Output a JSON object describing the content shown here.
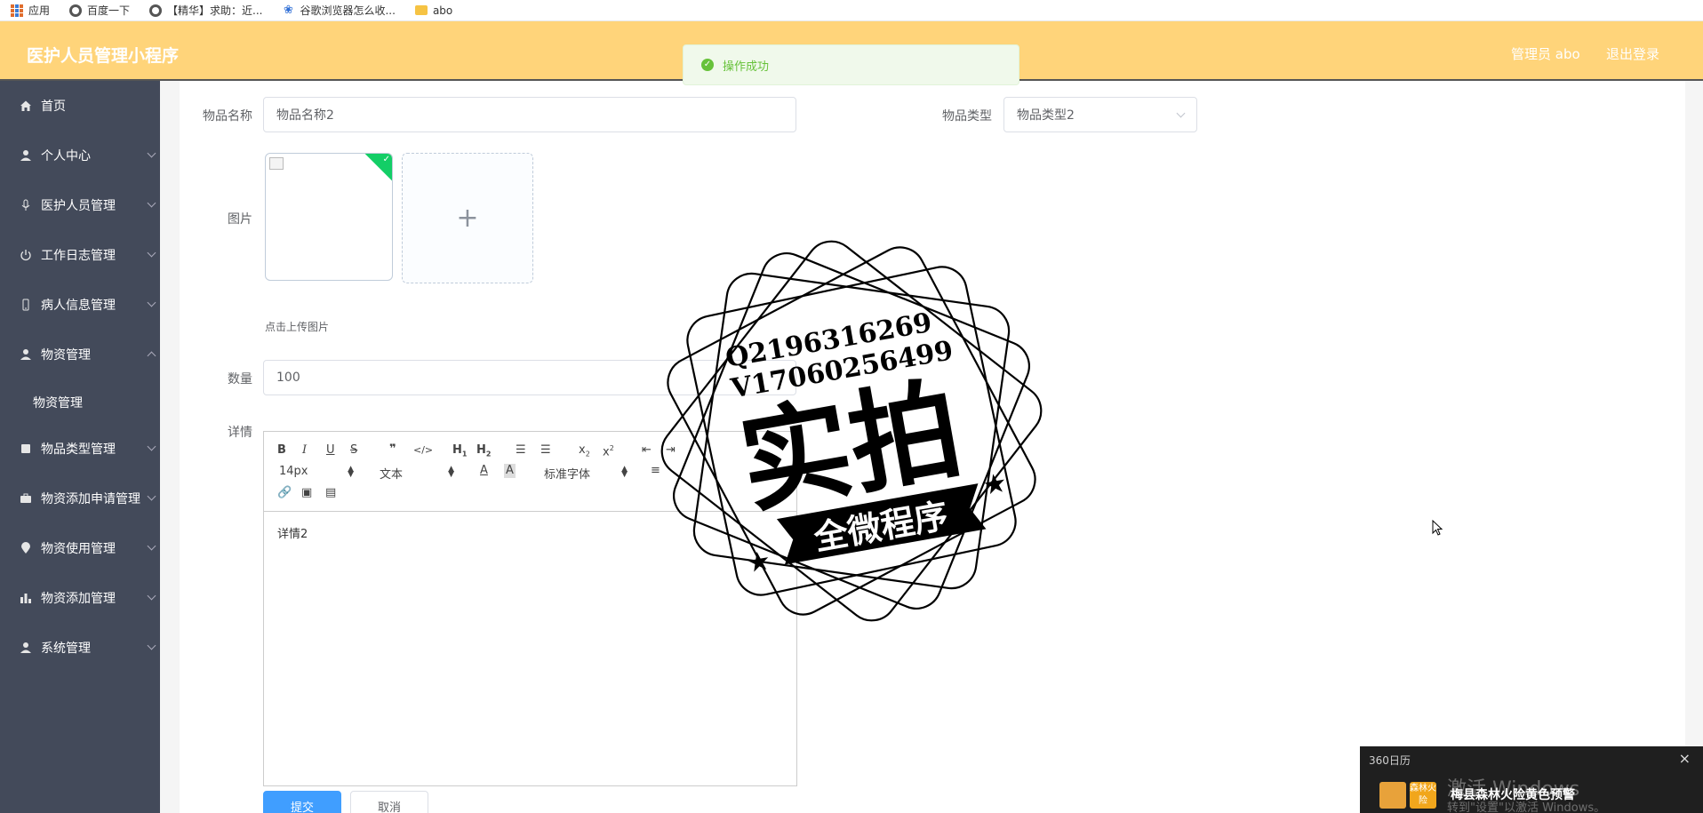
{
  "bookmarks": [
    {
      "label": "应用",
      "icon": "apps-grid-icon"
    },
    {
      "label": "百度一下",
      "icon": "globe-icon"
    },
    {
      "label": "【精华】求助：近...",
      "icon": "globe-icon"
    },
    {
      "label": "谷歌浏览器怎么收...",
      "icon": "baidu-paw-icon"
    },
    {
      "label": "abo",
      "icon": "folder-icon"
    }
  ],
  "header": {
    "title": "医护人员管理小程序",
    "user": "管理员 abo",
    "logout": "退出登录",
    "bg_color": "#ffd47a"
  },
  "toast": {
    "message": "操作成功",
    "color": "#67c23a"
  },
  "sidebar": {
    "bg_color": "#434a5a",
    "items": [
      {
        "label": "首页",
        "icon": "home-icon"
      },
      {
        "label": "个人中心",
        "icon": "user-icon"
      },
      {
        "label": "医护人员管理",
        "icon": "microphone-icon"
      },
      {
        "label": "工作日志管理",
        "icon": "power-icon"
      },
      {
        "label": "病人信息管理",
        "icon": "phone-icon"
      },
      {
        "label": "物资管理",
        "icon": "user-icon"
      },
      {
        "label": "物品类型管理",
        "icon": "document-icon"
      },
      {
        "label": "物资添加申请管理",
        "icon": "briefcase-icon"
      },
      {
        "label": "物资使用管理",
        "icon": "location-icon"
      },
      {
        "label": "物资添加管理",
        "icon": "bar-chart-icon"
      },
      {
        "label": "系统管理",
        "icon": "user-icon"
      }
    ],
    "active_sub": "物资管理"
  },
  "form": {
    "name_label": "物品名称",
    "name_value": "物品名称2",
    "type_label": "物品类型",
    "type_value": "物品类型2",
    "image_label": "图片",
    "upload_hint": "点击上传图片",
    "qty_label": "数量",
    "qty_value": "100",
    "detail_label": "详情",
    "detail_value": "详情2",
    "submit": "提交",
    "cancel": "取消"
  },
  "editor": {
    "font_size": "14px",
    "paragraph": "文本",
    "font_family": "标准字体"
  },
  "watermark": {
    "line1": "Q2196316269",
    "line2": "V17060256499",
    "main": "实拍",
    "banner": "全微程序"
  },
  "notification": {
    "app": "360日历",
    "message": "梅县森林火险黄色预警",
    "badge": "森林火险"
  },
  "os_overlay": {
    "activate_title": "激活 Windows",
    "activate_sub": "转到\"设置\"以激活 Windows。"
  }
}
